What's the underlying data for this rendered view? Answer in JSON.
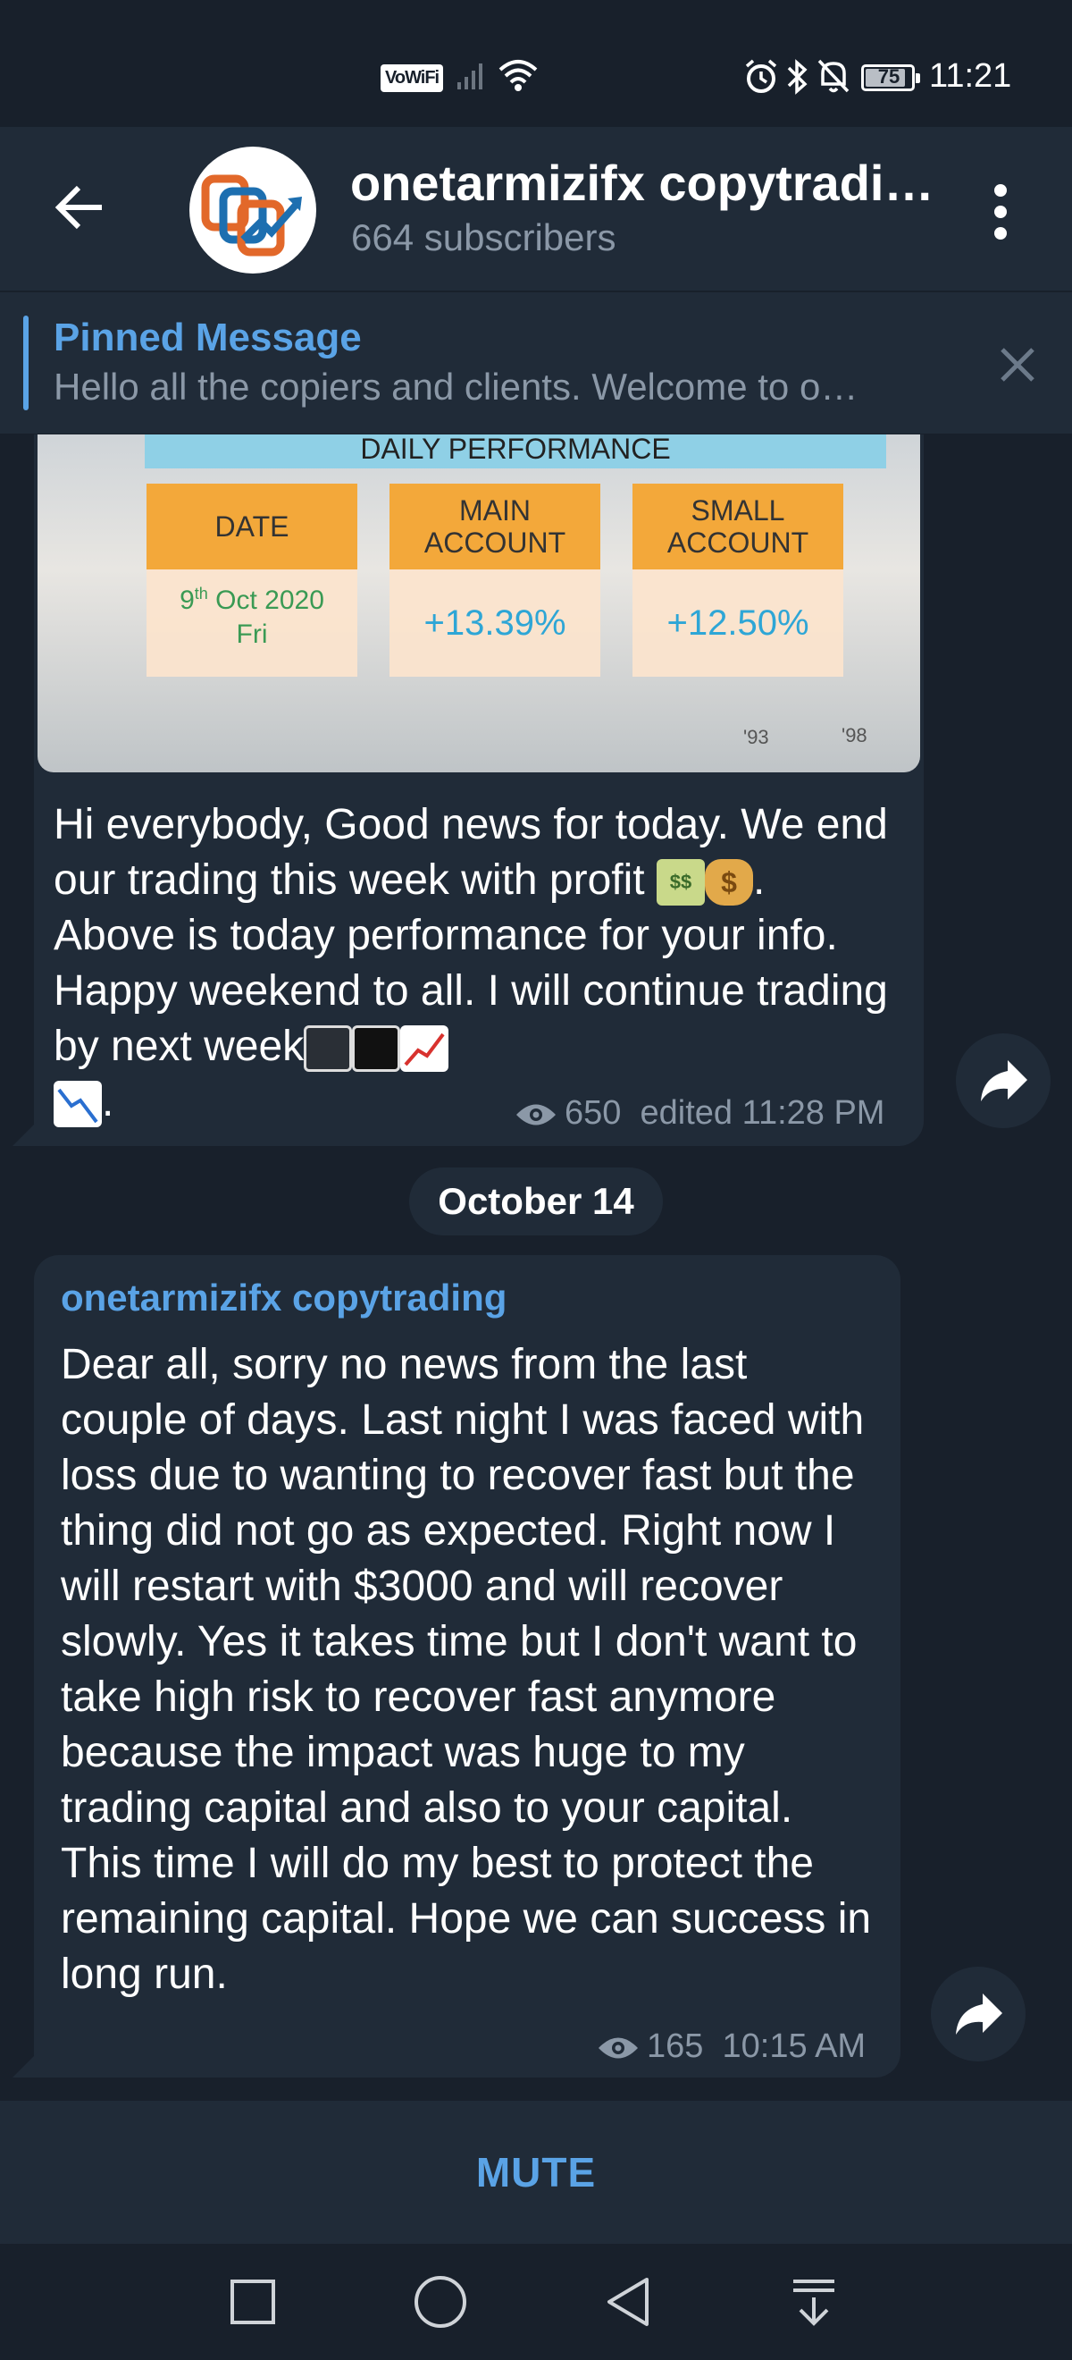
{
  "status_bar": {
    "wifi_label": "VoWiFi",
    "battery": "75",
    "time": "11:21",
    "icons": [
      "signal-icon",
      "wifi-icon",
      "alarm-icon",
      "bluetooth-icon",
      "silent-bell-icon",
      "battery-icon"
    ]
  },
  "header": {
    "channel_name": "onetarmizifx copytradi…",
    "subscribers": "664 subscribers"
  },
  "pinned": {
    "title": "Pinned Message",
    "text": "Hello all the copiers and clients. Welcome to o…"
  },
  "performance_image": {
    "banner": "DAILY PERFORMANCE",
    "col_date": "DATE",
    "col_main": "MAIN ACCOUNT",
    "col_small": "SMALL ACCOUNT",
    "date_day": "9",
    "date_suffix": "th",
    "date_rest": " Oct 2020",
    "weekday": "Fri",
    "main_value": "+13.39%",
    "small_value": "+12.50%",
    "bg_label_1": "'93",
    "bg_label_2": "'98"
  },
  "message1": {
    "text_part1": "Hi everybody, Good news for today. We end our trading this week with profit ",
    "text_part2": ". Above is today performance for your info. Happy weekend to all. I will continue trading by next week",
    "text_part3": ".",
    "views": "650",
    "time": "edited 11:28 PM"
  },
  "date_separator": "October 14",
  "message2": {
    "sender": "onetarmizifx copytrading",
    "text": "Dear all, sorry no news from the last couple of days. Last night I was faced with loss due to wanting to recover fast but the thing did not go as expected. Right now I will restart with $3000 and will recover slowly. Yes it takes time but I don't want to take high risk to recover fast anymore because the impact was huge to my trading capital and also to your capital. This time I will do my best to protect the remaining capital. Hope we can success in long run.",
    "views": "165",
    "time": "10:15 AM"
  },
  "bottom": {
    "mute_label": "MUTE"
  },
  "colors": {
    "background": "#18202b",
    "bubble": "#202b38",
    "accent": "#5aa3e6",
    "muted_text": "#8b98a7"
  }
}
